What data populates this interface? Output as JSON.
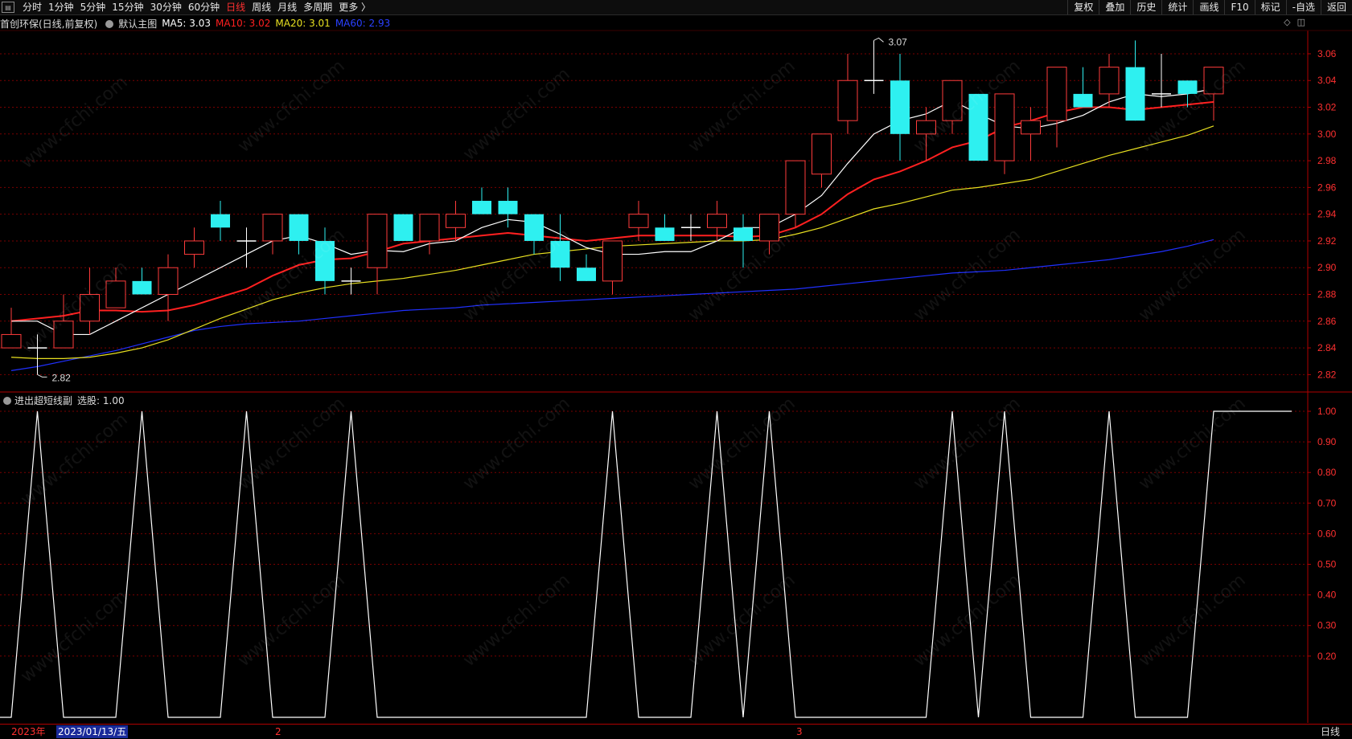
{
  "toolbar": {
    "periods": [
      "分时",
      "1分钟",
      "5分钟",
      "15分钟",
      "30分钟",
      "60分钟",
      "日线",
      "周线",
      "月线",
      "多周期",
      "更多 〉"
    ],
    "active_period": "日线",
    "right_items": [
      "复权",
      "叠加",
      "历史",
      "统计",
      "画线",
      "F10",
      "标记",
      "-自选",
      "返回"
    ]
  },
  "info": {
    "stock": "首创环保(日线,前复权)",
    "template": "默认主图",
    "ma5": "MA5: 3.03",
    "ma10": "MA10: 3.02",
    "ma20": "MA20: 3.01",
    "ma60": "MA60: 2.93"
  },
  "colors": {
    "ma5": "#ffffff",
    "ma10": "#ff2020",
    "ma20": "#e8e020",
    "ma60": "#2030ff",
    "up": "#ff3b3b",
    "down": "#2ef0f0",
    "grid": "#7a0000"
  },
  "price_axis": [
    "3.06",
    "3.04",
    "3.02",
    "3.00",
    "2.98",
    "2.96",
    "2.94",
    "2.92",
    "2.90",
    "2.88",
    "2.86",
    "2.84",
    "2.82"
  ],
  "price_annotations": {
    "high": "3.07",
    "low": "2.82"
  },
  "sub": {
    "title": "进出超短线副",
    "value": "选股: 1.00",
    "axis": [
      "1.00",
      "0.90",
      "0.80",
      "0.70",
      "0.60",
      "0.50",
      "0.40",
      "0.30",
      "0.20"
    ]
  },
  "footer": {
    "year": "2023年",
    "date": "2023/01/13/五",
    "month2": "2",
    "month3": "3",
    "period": "日线"
  },
  "watermark": "www.cfchi.com",
  "chart_data": {
    "type": "candlestick",
    "candles": [
      {
        "o": 2.84,
        "h": 2.87,
        "l": 2.84,
        "c": 2.85
      },
      {
        "o": 2.84,
        "h": 2.85,
        "l": 2.82,
        "c": 2.84
      },
      {
        "o": 2.84,
        "h": 2.88,
        "l": 2.84,
        "c": 2.86
      },
      {
        "o": 2.86,
        "h": 2.9,
        "l": 2.85,
        "c": 2.88
      },
      {
        "o": 2.87,
        "h": 2.9,
        "l": 2.87,
        "c": 2.89
      },
      {
        "o": 2.89,
        "h": 2.9,
        "l": 2.88,
        "c": 2.88
      },
      {
        "o": 2.88,
        "h": 2.91,
        "l": 2.86,
        "c": 2.9
      },
      {
        "o": 2.91,
        "h": 2.93,
        "l": 2.9,
        "c": 2.92
      },
      {
        "o": 2.94,
        "h": 2.95,
        "l": 2.92,
        "c": 2.93
      },
      {
        "o": 2.92,
        "h": 2.93,
        "l": 2.9,
        "c": 2.92
      },
      {
        "o": 2.92,
        "h": 2.94,
        "l": 2.91,
        "c": 2.94
      },
      {
        "o": 2.94,
        "h": 2.94,
        "l": 2.91,
        "c": 2.92
      },
      {
        "o": 2.92,
        "h": 2.93,
        "l": 2.88,
        "c": 2.89
      },
      {
        "o": 2.89,
        "h": 2.9,
        "l": 2.88,
        "c": 2.89
      },
      {
        "o": 2.9,
        "h": 2.94,
        "l": 2.88,
        "c": 2.94
      },
      {
        "o": 2.94,
        "h": 2.94,
        "l": 2.92,
        "c": 2.92
      },
      {
        "o": 2.92,
        "h": 2.94,
        "l": 2.91,
        "c": 2.94
      },
      {
        "o": 2.93,
        "h": 2.95,
        "l": 2.92,
        "c": 2.94
      },
      {
        "o": 2.95,
        "h": 2.96,
        "l": 2.94,
        "c": 2.94
      },
      {
        "o": 2.95,
        "h": 2.96,
        "l": 2.93,
        "c": 2.94
      },
      {
        "o": 2.94,
        "h": 2.94,
        "l": 2.91,
        "c": 2.92
      },
      {
        "o": 2.92,
        "h": 2.94,
        "l": 2.89,
        "c": 2.9
      },
      {
        "o": 2.9,
        "h": 2.91,
        "l": 2.89,
        "c": 2.89
      },
      {
        "o": 2.89,
        "h": 2.92,
        "l": 2.88,
        "c": 2.92
      },
      {
        "o": 2.93,
        "h": 2.95,
        "l": 2.92,
        "c": 2.94
      },
      {
        "o": 2.93,
        "h": 2.94,
        "l": 2.92,
        "c": 2.92
      },
      {
        "o": 2.93,
        "h": 2.94,
        "l": 2.92,
        "c": 2.93
      },
      {
        "o": 2.93,
        "h": 2.95,
        "l": 2.92,
        "c": 2.94
      },
      {
        "o": 2.93,
        "h": 2.94,
        "l": 2.9,
        "c": 2.92
      },
      {
        "o": 2.92,
        "h": 2.94,
        "l": 2.91,
        "c": 2.94
      },
      {
        "o": 2.94,
        "h": 2.98,
        "l": 2.93,
        "c": 2.98
      },
      {
        "o": 2.97,
        "h": 3.0,
        "l": 2.96,
        "c": 3.0
      },
      {
        "o": 3.01,
        "h": 3.06,
        "l": 3.0,
        "c": 3.04
      },
      {
        "o": 3.04,
        "h": 3.07,
        "l": 3.03,
        "c": 3.04
      },
      {
        "o": 3.04,
        "h": 3.06,
        "l": 2.98,
        "c": 3.0
      },
      {
        "o": 3.0,
        "h": 3.02,
        "l": 2.98,
        "c": 3.01
      },
      {
        "o": 3.01,
        "h": 3.04,
        "l": 3.0,
        "c": 3.04
      },
      {
        "o": 3.03,
        "h": 3.03,
        "l": 2.98,
        "c": 2.98
      },
      {
        "o": 2.98,
        "h": 3.03,
        "l": 2.97,
        "c": 3.03
      },
      {
        "o": 3.0,
        "h": 3.02,
        "l": 2.98,
        "c": 3.01
      },
      {
        "o": 3.01,
        "h": 3.05,
        "l": 2.99,
        "c": 3.05
      },
      {
        "o": 3.03,
        "h": 3.05,
        "l": 3.02,
        "c": 3.02
      },
      {
        "o": 3.03,
        "h": 3.06,
        "l": 3.02,
        "c": 3.05
      },
      {
        "o": 3.05,
        "h": 3.07,
        "l": 3.01,
        "c": 3.01
      },
      {
        "o": 3.03,
        "h": 3.06,
        "l": 3.02,
        "c": 3.03
      },
      {
        "o": 3.04,
        "h": 3.04,
        "l": 3.02,
        "c": 3.03
      },
      {
        "o": 3.03,
        "h": 3.05,
        "l": 3.01,
        "c": 3.05
      }
    ],
    "ma5": [
      2.86,
      2.86,
      2.85,
      2.85,
      2.86,
      2.87,
      2.88,
      2.89,
      2.9,
      2.91,
      2.92,
      2.924,
      2.918,
      2.91,
      2.913,
      2.912,
      2.918,
      2.92,
      2.93,
      2.936,
      2.934,
      2.925,
      2.915,
      2.91,
      2.91,
      2.912,
      2.912,
      2.92,
      2.93,
      2.93,
      2.94,
      2.954,
      2.978,
      3.0,
      3.01,
      3.015,
      3.025,
      3.015,
      3.006,
      3.004,
      3.008,
      3.014,
      3.024,
      3.03,
      3.028,
      3.03,
      3.034
    ],
    "ma10": [
      2.86,
      2.862,
      2.864,
      2.868,
      2.868,
      2.867,
      2.868,
      2.872,
      2.878,
      2.884,
      2.894,
      2.902,
      2.906,
      2.907,
      2.912,
      2.918,
      2.92,
      2.922,
      2.924,
      2.926,
      2.924,
      2.922,
      2.92,
      2.922,
      2.924,
      2.924,
      2.924,
      2.924,
      2.923,
      2.924,
      2.93,
      2.94,
      2.955,
      2.966,
      2.972,
      2.98,
      2.99,
      2.995,
      3.005,
      3.01,
      3.016,
      3.02,
      3.02,
      3.018,
      3.02,
      3.022,
      3.024
    ],
    "ma20": [
      2.833,
      2.832,
      2.832,
      2.833,
      2.836,
      2.84,
      2.846,
      2.854,
      2.862,
      2.869,
      2.876,
      2.881,
      2.885,
      2.888,
      2.89,
      2.892,
      2.895,
      2.898,
      2.902,
      2.906,
      2.91,
      2.912,
      2.914,
      2.916,
      2.917,
      2.918,
      2.919,
      2.92,
      2.92,
      2.921,
      2.925,
      2.93,
      2.937,
      2.944,
      2.948,
      2.953,
      2.958,
      2.96,
      2.963,
      2.966,
      2.972,
      2.978,
      2.984,
      2.989,
      2.994,
      2.999,
      3.006
    ],
    "ma60": [
      2.823,
      2.826,
      2.83,
      2.834,
      2.838,
      2.843,
      2.848,
      2.853,
      2.856,
      2.858,
      2.859,
      2.86,
      2.862,
      2.864,
      2.866,
      2.868,
      2.869,
      2.87,
      2.872,
      2.873,
      2.874,
      2.875,
      2.876,
      2.877,
      2.878,
      2.879,
      2.88,
      2.881,
      2.882,
      2.883,
      2.884,
      2.886,
      2.888,
      2.89,
      2.892,
      2.894,
      2.896,
      2.897,
      2.898,
      2.9,
      2.902,
      2.904,
      2.906,
      2.909,
      2.912,
      2.916,
      2.921
    ],
    "signal": [
      0,
      1,
      0,
      0,
      0,
      1,
      0,
      0,
      0,
      1,
      0,
      0,
      0,
      1,
      0,
      0,
      0,
      0,
      0,
      0,
      0,
      0,
      0,
      1,
      0,
      0,
      0,
      1,
      0,
      1,
      0,
      0,
      0,
      0,
      0,
      0,
      1,
      0,
      1,
      0,
      0,
      0,
      1,
      0,
      0,
      0,
      1
    ],
    "price_range": [
      2.81,
      3.075
    ],
    "signal_range": [
      0.0,
      1.0
    ]
  }
}
